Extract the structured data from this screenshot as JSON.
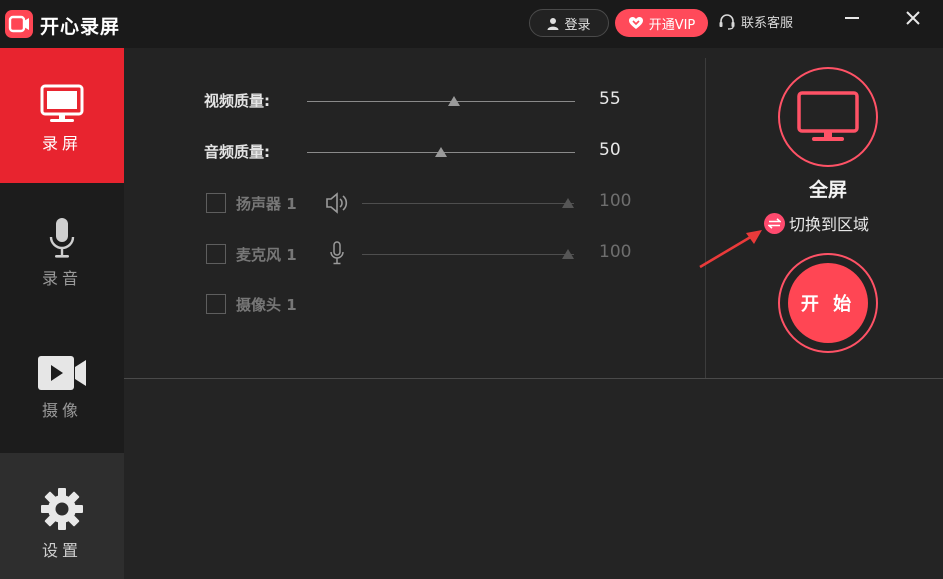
{
  "app": {
    "title": "开心录屏"
  },
  "header": {
    "login_label": "登录",
    "vip_label": "开通VIP",
    "service_label": "联系客服"
  },
  "sidebar": {
    "items": [
      {
        "label": "录屏",
        "icon": "monitor-icon",
        "active": true
      },
      {
        "label": "录音",
        "icon": "microphone-icon",
        "active": false
      },
      {
        "label": "摄像",
        "icon": "video-camera-icon",
        "active": false
      },
      {
        "label": "设置",
        "icon": "gear-icon",
        "active": false
      }
    ]
  },
  "settings": {
    "video_quality": {
      "label": "视频质量:",
      "value": "55",
      "level": 0.55
    },
    "audio_quality": {
      "label": "音频质量:",
      "value": "50",
      "level": 0.5
    },
    "speaker": {
      "label": "扬声器 1",
      "value": "100",
      "level": 1.0,
      "checked": false,
      "icon": "speaker-icon"
    },
    "microphone": {
      "label": "麦克风 1",
      "value": "100",
      "level": 1.0,
      "checked": false,
      "icon": "microphone-icon"
    },
    "camera": {
      "label": "摄像头 1",
      "checked": false
    }
  },
  "mode_panel": {
    "title": "全屏",
    "switch_label": "切换到区域",
    "start_label": "开 始"
  },
  "colors": {
    "accent": "#ff4654",
    "active_nav": "#e8242f",
    "background": "#232323"
  }
}
